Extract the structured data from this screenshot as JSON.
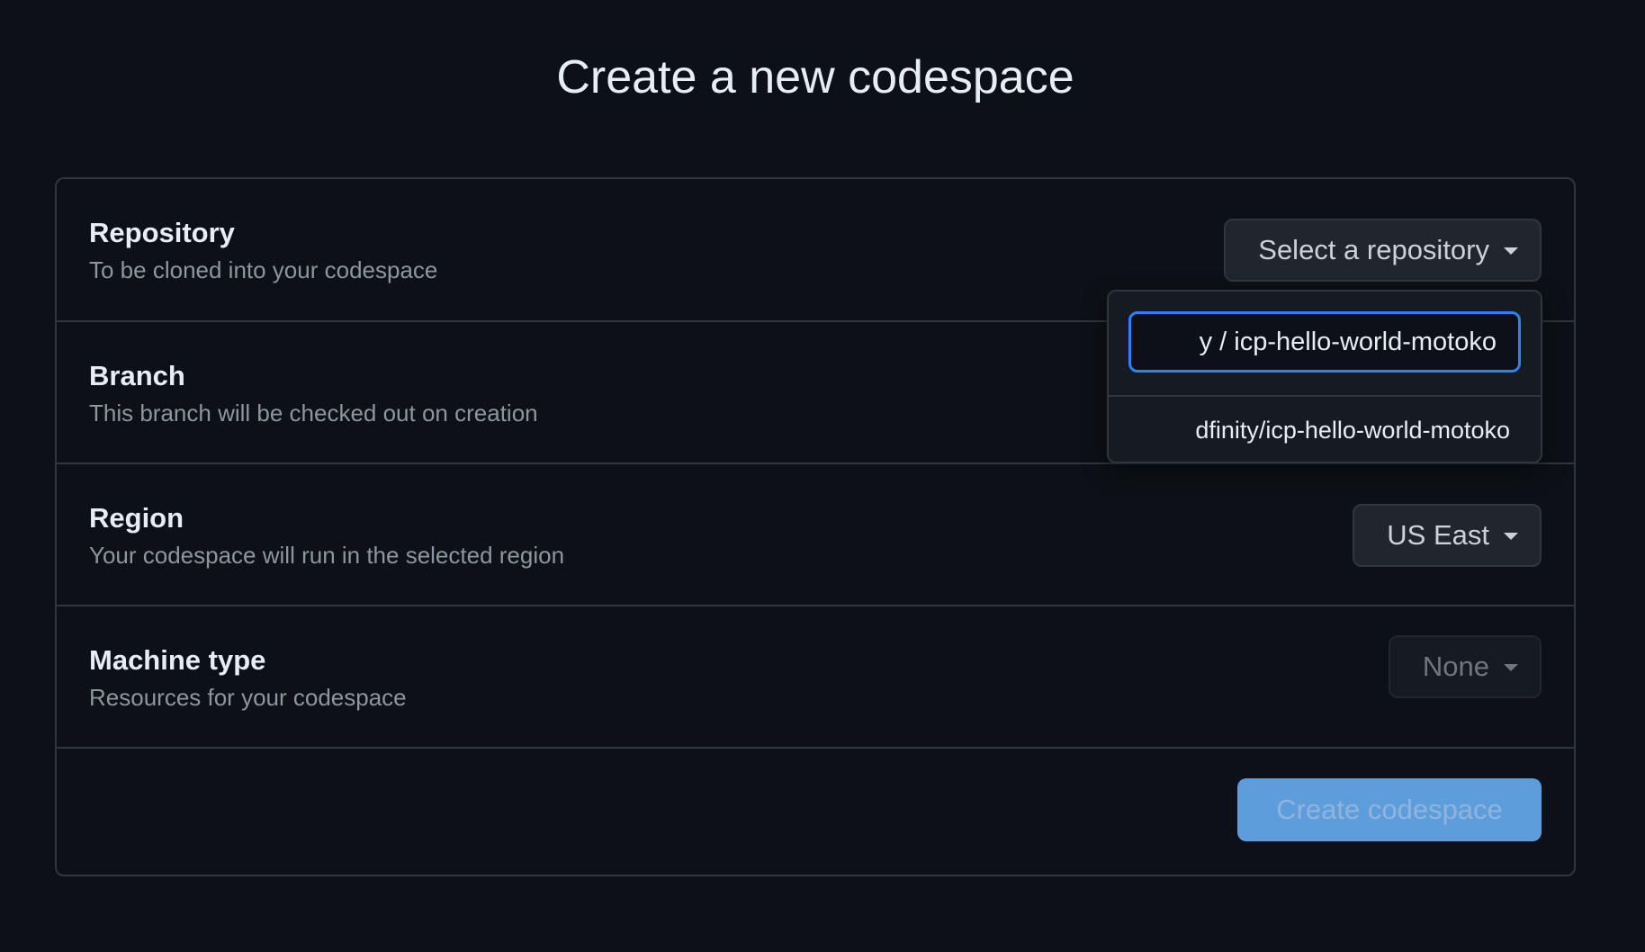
{
  "page": {
    "title": "Create a new codespace"
  },
  "repository": {
    "label": "Repository",
    "description": "To be cloned into your codespace",
    "button_label": "Select a repository",
    "filter_value": "y / icp-hello-world-motoko",
    "results": [
      "dfinity/icp-hello-world-motoko"
    ]
  },
  "branch": {
    "label": "Branch",
    "description": "This branch will be checked out on creation"
  },
  "region": {
    "label": "Region",
    "description": "Your codespace will run in the selected region",
    "selected": "US East"
  },
  "machine": {
    "label": "Machine type",
    "description": "Resources for your codespace",
    "selected": "None"
  },
  "actions": {
    "create_label": "Create codespace"
  },
  "colors": {
    "background": "#0d1117",
    "border": "#30363d",
    "focus": "#2f81f7",
    "primary_disabled": "#6cb6ff"
  }
}
